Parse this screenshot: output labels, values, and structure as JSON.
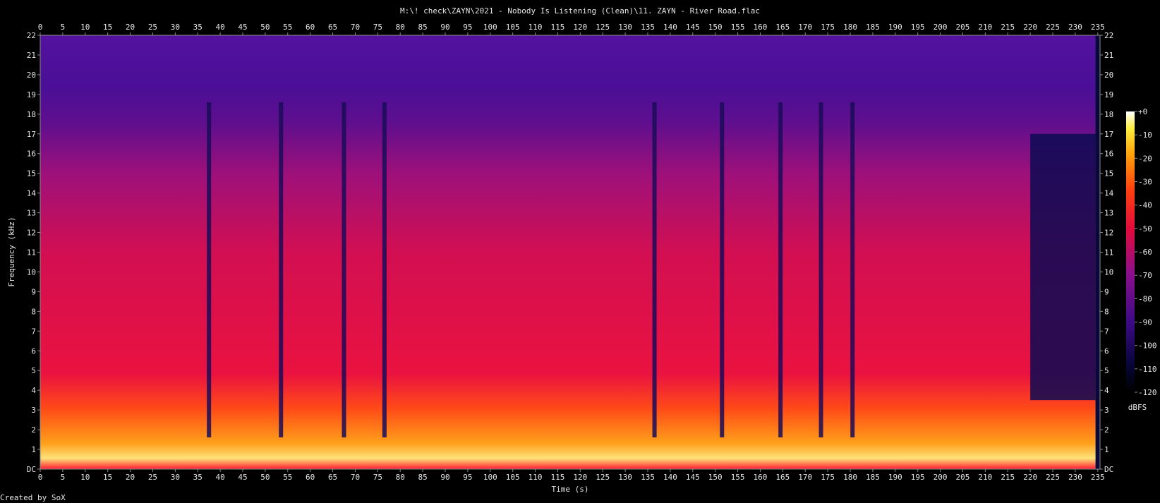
{
  "title": "M:\\! check\\ZAYN\\2021 - Nobody Is Listening (Clean)\\11. ZAYN - River Road.flac",
  "credit": "Created by SoX",
  "colors": {
    "background": "#000000",
    "axis": "#8c8c8c",
    "text": "#e6e6e6"
  },
  "chart_data": {
    "type": "heatmap",
    "title": "M:\\! check\\ZAYN\\2021 - Nobody Is Listening (Clean)\\11. ZAYN - River Road.flac",
    "xlabel": "Time (s)",
    "ylabel": "Frequency (kHz)",
    "x_ticks": [
      "0",
      "5",
      "10",
      "15",
      "20",
      "25",
      "30",
      "35",
      "40",
      "45",
      "50",
      "55",
      "60",
      "65",
      "70",
      "75",
      "80",
      "85",
      "90",
      "95",
      "100",
      "105",
      "110",
      "115",
      "120",
      "125",
      "130",
      "135",
      "140",
      "145",
      "150",
      "155",
      "160",
      "165",
      "170",
      "175",
      "180",
      "185",
      "190",
      "195",
      "200",
      "205",
      "210",
      "215",
      "220",
      "225",
      "230",
      "235"
    ],
    "y_ticks": [
      "DC",
      "1",
      "2",
      "3",
      "4",
      "5",
      "6",
      "7",
      "8",
      "9",
      "10",
      "11",
      "12",
      "13",
      "14",
      "15",
      "16",
      "17",
      "18",
      "19",
      "20",
      "21",
      "22"
    ],
    "xlim": [
      0,
      235.5
    ],
    "ylim": [
      0,
      22
    ],
    "colorbar": {
      "label": "dBFS",
      "ticks": [
        "+0",
        "-10",
        "-20",
        "-30",
        "-40",
        "-50",
        "-60",
        "-70",
        "-80",
        "-90",
        "-100",
        "-110",
        "-120"
      ],
      "range": [
        -120,
        0
      ]
    },
    "track_end_s": 234.5,
    "highband_cutoff_after_s": 220,
    "quiet_gaps_s": [
      37.5,
      53.5,
      67.5,
      76.5,
      136.5,
      151.5,
      164.5,
      173.5,
      180.5
    ]
  }
}
